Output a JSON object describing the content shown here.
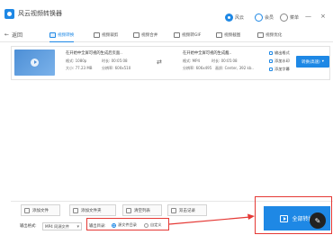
{
  "app": {
    "title": "风云视频转换器"
  },
  "toolbar": {
    "user": "风云",
    "member": "会员",
    "more": "菜单"
  },
  "window": {
    "minimize": "—",
    "close": "×"
  },
  "nav": {
    "back_label": "返回",
    "tabs": [
      {
        "label": "视频转换",
        "active": true
      },
      {
        "label": "视频裁剪",
        "active": false
      },
      {
        "label": "视频合并",
        "active": false
      },
      {
        "label": "视频转GIF",
        "active": false
      },
      {
        "label": "视频截图",
        "active": false
      },
      {
        "label": "视频优化",
        "active": false
      }
    ]
  },
  "file": {
    "name_src": "在开始中全屏可视的生成后页面..",
    "format_src_label": "格式: 1080p",
    "duration_src": "时长: 00:05:08",
    "size_src": "大小: 77.23 MB",
    "resolution_src": "分辨率: 600x510",
    "name_dst": "在开始中全屏可视的生成后..",
    "format_dst": "格式: MP4",
    "duration_dst": "时长: 00:05:08",
    "resolution_dst": "分辨率: 606x495",
    "quality_dst": "画质: Center, 392 kb..",
    "actions": [
      "输出格式",
      "添加水印",
      "添加字幕"
    ],
    "format_button": "转换(高速)"
  },
  "bottom": {
    "buttons": [
      "添加文件",
      "添加文件夹",
      "清空列表",
      "双击记录"
    ],
    "output_format_label": "输出格式:",
    "output_format_value": "MP4 同源文件",
    "output_dir_label": "输出目录:",
    "radio_source": "源文件目录",
    "radio_custom": "自定义",
    "convert_all": "全部转换"
  },
  "colors": {
    "accent": "#1e88e5",
    "highlight": "#e53935"
  },
  "icons": [
    "app-logo-icon",
    "user-icon",
    "member-icon",
    "menu-icon",
    "play-icon",
    "shuffle-icon",
    "edit-icon",
    "compose-icon"
  ]
}
